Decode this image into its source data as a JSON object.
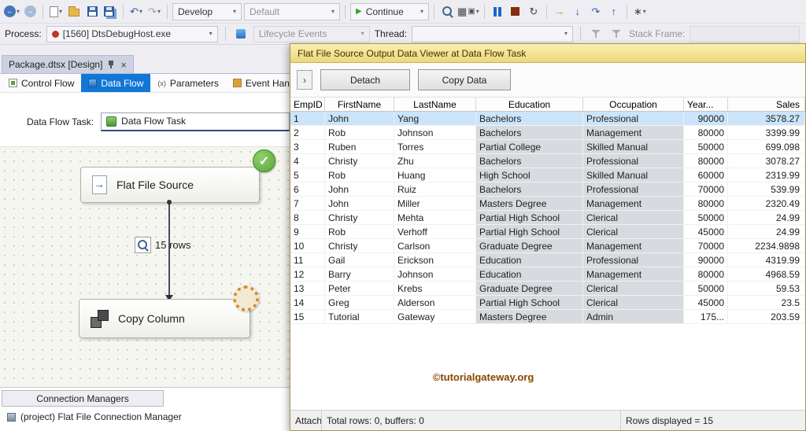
{
  "icons": {
    "caret": "▾",
    "arrow_left": "←",
    "arrow_right": "→",
    "undo": "↶",
    "redo": "↷",
    "play": "▶",
    "restart": "↻",
    "step_into": "↓",
    "step_over": "↷",
    "step_out": "↑",
    "next_statement": "→",
    "grid": "▦",
    "monitor": "▣",
    "sparkle": "∗",
    "close": "×",
    "check": "✓",
    "expander": "›",
    "param": "(x)"
  },
  "colors": {
    "accent_blue": "#1177d7",
    "selected_row": "#cbe4f9",
    "viewer_titlebar": "#f5e9a9",
    "watermark": "#8a4500",
    "success_green": "#57a53a",
    "stop_red": "#822c0e"
  },
  "toolbar": {
    "develop": "Develop",
    "default_config": "Default",
    "continue_label": "Continue"
  },
  "debug_bar": {
    "process_label": "Process:",
    "process_value": "[1560] DtsDebugHost.exe",
    "lifecycle_events": "Lifecycle Events",
    "thread_label": "Thread:",
    "stack_frame_label": "Stack Frame:"
  },
  "editor": {
    "document_tab": "Package.dtsx [Design]",
    "tabs": [
      "Control Flow",
      "Data Flow",
      "Parameters",
      "Event Handlers"
    ],
    "active_tab": "Data Flow"
  },
  "designer": {
    "task_label": "Data Flow Task:",
    "task_value": "Data Flow Task",
    "source_label": "Flat File Source",
    "rows_badge": "15 rows",
    "copy_label": "Copy Column"
  },
  "connection": {
    "header": "Connection Managers",
    "item": "(project) Flat File Connection Manager"
  },
  "viewer": {
    "title": "Flat File Source Output Data Viewer at Data Flow Task",
    "detach_label": "Detach",
    "copy_data_label": "Copy Data",
    "columns": [
      "EmpID",
      "FirstName",
      "LastName",
      "Education",
      "Occupation",
      "Year...",
      "Sales"
    ],
    "selected_row_index": 0,
    "rows": [
      [
        "1",
        "John",
        "Yang",
        "Bachelors",
        "Professional",
        "90000",
        "3578.27"
      ],
      [
        "2",
        "Rob",
        "Johnson",
        "Bachelors",
        "Management",
        "80000",
        "3399.99"
      ],
      [
        "3",
        "Ruben",
        "Torres",
        "Partial College",
        "Skilled Manual",
        "50000",
        "699.098"
      ],
      [
        "4",
        "Christy",
        "Zhu",
        "Bachelors",
        "Professional",
        "80000",
        "3078.27"
      ],
      [
        "5",
        "Rob",
        "Huang",
        "High School",
        "Skilled Manual",
        "60000",
        "2319.99"
      ],
      [
        "6",
        "John",
        "Ruiz",
        "Bachelors",
        "Professional",
        "70000",
        "539.99"
      ],
      [
        "7",
        "John",
        "Miller",
        "Masters Degree",
        "Management",
        "80000",
        "2320.49"
      ],
      [
        "8",
        "Christy",
        "Mehta",
        "Partial High School",
        "Clerical",
        "50000",
        "24.99"
      ],
      [
        "9",
        "Rob",
        "Verhoff",
        "Partial High School",
        "Clerical",
        "45000",
        "24.99"
      ],
      [
        "10",
        "Christy",
        "Carlson",
        "Graduate Degree",
        "Management",
        "70000",
        "2234.9898"
      ],
      [
        "11",
        "Gail",
        "Erickson",
        "Education",
        "Professional",
        "90000",
        "4319.99"
      ],
      [
        "12",
        "Barry",
        "Johnson",
        "Education",
        "Management",
        "80000",
        "4968.59"
      ],
      [
        "13",
        "Peter",
        "Krebs",
        "Graduate Degree",
        "Clerical",
        "50000",
        "59.53"
      ],
      [
        "14",
        "Greg",
        "Alderson",
        "Partial High School",
        "Clerical",
        "45000",
        "23.5"
      ],
      [
        "15",
        "Tutorial",
        "Gateway",
        "Masters Degree",
        "Admin",
        "175...",
        "203.59"
      ]
    ],
    "watermark": "©tutorialgateway.org",
    "status": {
      "attached": "Attache",
      "totals": "Total rows: 0, buffers: 0",
      "rows_displayed": "Rows displayed = 15"
    }
  }
}
